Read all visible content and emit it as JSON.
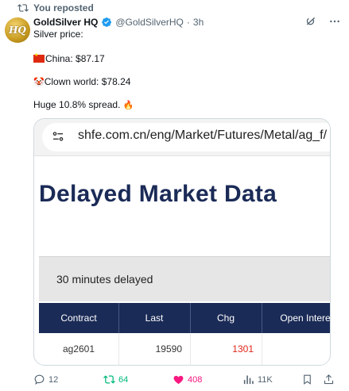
{
  "repost": {
    "label": "You reposted"
  },
  "author": {
    "avatar_text": "HQ",
    "name": "GoldSilver HQ",
    "handle": "@GoldSilverHQ",
    "dot": "·",
    "time": "3h"
  },
  "tweet": {
    "line1": "Silver price:",
    "line2": "China: $87.17",
    "line3": "Clown world: $78.24",
    "line4": "Huge 10.8% spread.",
    "fire_emoji": "🔥",
    "clown_emoji": "🤡"
  },
  "card": {
    "url": "shfe.com.cn/eng/Market/Futures/Metal/ag_f/",
    "title": "Delayed Market Data",
    "delay_note": "30 minutes delayed",
    "table": {
      "headers": [
        "Contract",
        "Last",
        "Chg",
        "Open Intere"
      ],
      "row": {
        "contract": "ag2601",
        "last": "19590",
        "chg": "1301",
        "chg_color": "#e0261b"
      }
    }
  },
  "actions": {
    "replies": "12",
    "reposts": "64",
    "likes": "408",
    "views": "11K"
  },
  "colors": {
    "accent_green": "#00ba7c",
    "like_pink": "#f91880",
    "verified_blue": "#1d9bf0",
    "table_navy": "#1b2b57"
  }
}
